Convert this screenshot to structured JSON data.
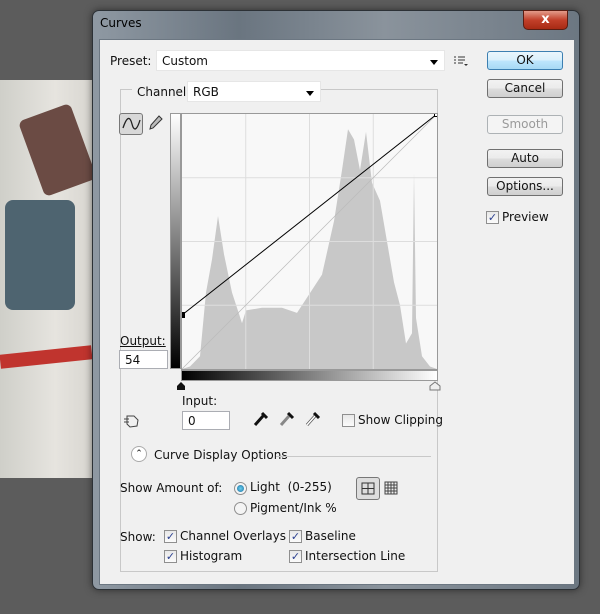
{
  "window": {
    "title": "Curves",
    "close_glyph": "x"
  },
  "preset": {
    "label": "Preset:",
    "value": "Custom"
  },
  "channel": {
    "label": "Channel:",
    "value": "RGB"
  },
  "buttons": {
    "ok": "OK",
    "cancel": "Cancel",
    "smooth": "Smooth",
    "auto": "Auto",
    "options": "Options..."
  },
  "preview": {
    "label": "Preview",
    "checked": true
  },
  "output": {
    "label": "Output:",
    "value": "54"
  },
  "input": {
    "label": "Input:",
    "value": "0"
  },
  "show_clipping": {
    "label": "Show Clipping",
    "checked": false
  },
  "curve_display": {
    "label": "Curve Display Options"
  },
  "show_amount": {
    "label": "Show Amount of:",
    "options": [
      {
        "label": "Light  (0-255)",
        "selected": true
      },
      {
        "label": "Pigment/Ink %",
        "selected": false
      }
    ]
  },
  "show": {
    "label": "Show:",
    "items": [
      {
        "label": "Channel Overlays",
        "checked": true
      },
      {
        "label": "Baseline",
        "checked": true
      },
      {
        "label": "Histogram",
        "checked": true
      },
      {
        "label": "Intersection Line",
        "checked": true
      }
    ]
  },
  "curve": {
    "points": [
      [
        0,
        54
      ],
      [
        255,
        255
      ]
    ],
    "range": [
      0,
      255
    ]
  },
  "colors": {
    "histogram": "#c8c8c8",
    "curve": "#000000",
    "ok_border": "#3c7fb1"
  }
}
